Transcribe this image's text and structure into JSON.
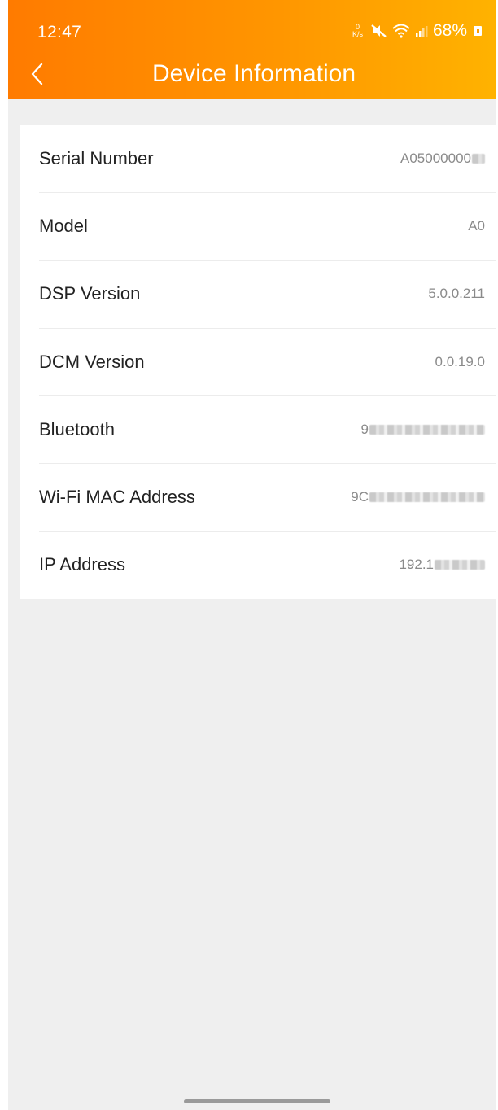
{
  "status_bar": {
    "time": "12:47",
    "net_speed_value": "0",
    "net_speed_unit": "K/s",
    "battery": "68%",
    "icons": [
      "network-speed-icon",
      "mute-icon",
      "wifi-icon",
      "signal-icon",
      "battery-icon"
    ]
  },
  "header": {
    "title": "Device Information",
    "back_icon": "chevron-left-icon",
    "gradient": [
      "#ff7a00",
      "#ffb400"
    ]
  },
  "info_rows": [
    {
      "label": "Serial Number",
      "value": "A05000000"
    },
    {
      "label": "Model",
      "value": "A0"
    },
    {
      "label": "DSP Version",
      "value": "5.0.0.211"
    },
    {
      "label": "DCM Version",
      "value": "0.0.19.0"
    },
    {
      "label": "Bluetooth",
      "value": "9"
    },
    {
      "label": "Wi-Fi MAC Address",
      "value": "9C"
    },
    {
      "label": "IP Address",
      "value": "192.1"
    }
  ],
  "colors": {
    "background": "#efefef",
    "card": "#ffffff",
    "label_text": "#222222",
    "value_text": "#8a8a8a"
  }
}
